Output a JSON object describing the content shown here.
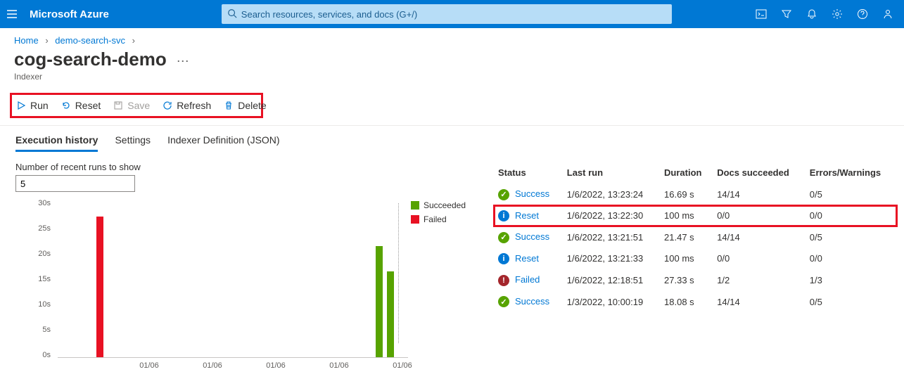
{
  "brand": "Microsoft Azure",
  "search": {
    "placeholder": "Search resources, services, and docs (G+/)"
  },
  "breadcrumbs": {
    "home": "Home",
    "svc": "demo-search-svc"
  },
  "title": "cog-search-demo",
  "subtitle": "Indexer",
  "toolbar": {
    "run": "Run",
    "reset": "Reset",
    "save": "Save",
    "refresh": "Refresh",
    "delete": "Delete"
  },
  "tabs": {
    "history": "Execution history",
    "settings": "Settings",
    "definition": "Indexer Definition (JSON)"
  },
  "runs_label": "Number of recent runs to show",
  "runs_value": "5",
  "legend": {
    "succeeded": "Succeeded",
    "failed": "Failed"
  },
  "chart_data": {
    "type": "bar",
    "ylabel_unit": "s",
    "ylim": [
      0,
      30
    ],
    "yticks": [
      "0s",
      "5s",
      "10s",
      "15s",
      "20s",
      "25s",
      "30s"
    ],
    "xticks": [
      "01/06",
      "01/06",
      "01/06",
      "01/06",
      "01/06"
    ],
    "series": [
      {
        "name": "Failed",
        "color": "#e81123",
        "bars": [
          {
            "x_pct": 12,
            "value_s": 27.33
          }
        ]
      },
      {
        "name": "Succeeded",
        "color": "#57a300",
        "bars": [
          {
            "x_pct": 90,
            "value_s": 21.47
          },
          {
            "x_pct": 93,
            "value_s": 16.69
          }
        ]
      }
    ]
  },
  "table": {
    "headers": {
      "status": "Status",
      "last_run": "Last run",
      "duration": "Duration",
      "docs": "Docs succeeded",
      "errs": "Errors/Warnings"
    },
    "rows": [
      {
        "kind": "success",
        "status": "Success",
        "last_run": "1/6/2022, 13:23:24",
        "duration": "16.69 s",
        "docs": "14/14",
        "errs": "0/5",
        "hl": false
      },
      {
        "kind": "info",
        "status": "Reset",
        "last_run": "1/6/2022, 13:22:30",
        "duration": "100 ms",
        "docs": "0/0",
        "errs": "0/0",
        "hl": true
      },
      {
        "kind": "success",
        "status": "Success",
        "last_run": "1/6/2022, 13:21:51",
        "duration": "21.47 s",
        "docs": "14/14",
        "errs": "0/5",
        "hl": false
      },
      {
        "kind": "info",
        "status": "Reset",
        "last_run": "1/6/2022, 13:21:33",
        "duration": "100 ms",
        "docs": "0/0",
        "errs": "0/0",
        "hl": false
      },
      {
        "kind": "fail",
        "status": "Failed",
        "last_run": "1/6/2022, 12:18:51",
        "duration": "27.33 s",
        "docs": "1/2",
        "errs": "1/3",
        "hl": false
      },
      {
        "kind": "success",
        "status": "Success",
        "last_run": "1/3/2022, 10:00:19",
        "duration": "18.08 s",
        "docs": "14/14",
        "errs": "0/5",
        "hl": false
      }
    ]
  }
}
